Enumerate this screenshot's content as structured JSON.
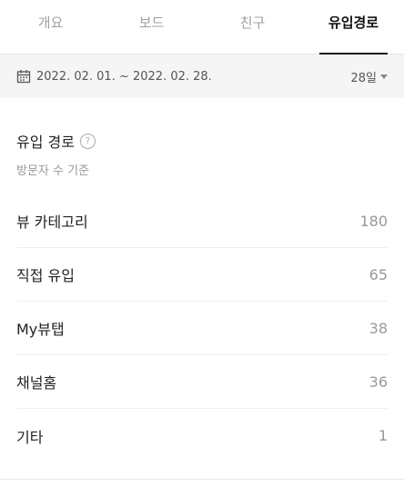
{
  "tabs": [
    {
      "label": "개요"
    },
    {
      "label": "보드"
    },
    {
      "label": "친구"
    },
    {
      "label": "유입경로"
    }
  ],
  "date_range": {
    "icon": "calendar-icon",
    "text": "2022. 02. 01. ~ 2022. 02. 28.",
    "period_label": "28일"
  },
  "section": {
    "title": "유입 경로",
    "subtitle": "방문자 수 기준",
    "help_icon": "?"
  },
  "rows": [
    {
      "label": "뷰 카테고리",
      "value": "180"
    },
    {
      "label": "직접 유입",
      "value": "65"
    },
    {
      "label": "My뷰탭",
      "value": "38"
    },
    {
      "label": "채널홈",
      "value": "36"
    },
    {
      "label": "기타",
      "value": "1"
    }
  ]
}
